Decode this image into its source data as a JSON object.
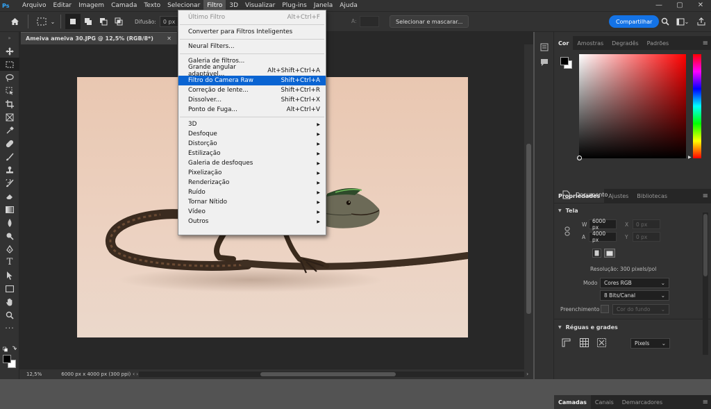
{
  "app": {
    "logo": "Ps"
  },
  "menubar": {
    "items": [
      "Arquivo",
      "Editar",
      "Imagem",
      "Camada",
      "Texto",
      "Selecionar",
      "Filtro",
      "3D",
      "Visualizar",
      "Plug-ins",
      "Janela",
      "Ajuda"
    ]
  },
  "window_controls": {
    "minimize": "—",
    "maximize": "▢",
    "close": "✕"
  },
  "options": {
    "difusao_label": "Difusão:",
    "difusao_value": "0 px",
    "largura_label": "A:",
    "select_mask": "Selecionar e mascarar...",
    "share": "Compartilhar"
  },
  "document": {
    "tab_title": "Ameiva ameiva 30.JPG @ 12,5% (RGB/8*)",
    "zoom": "12,5%",
    "info": "6000 px x 4000 px (300 ppi)"
  },
  "filter_menu": {
    "last_filter": {
      "label": "Último Filtro",
      "shortcut": "Alt+Ctrl+F"
    },
    "smart": "Converter para Filtros Inteligentes",
    "neural": "Neural Filters...",
    "items1": [
      {
        "label": "Galeria de filtros...",
        "shortcut": ""
      },
      {
        "label": "Grande angular adaptável...",
        "shortcut": "Alt+Shift+Ctrl+A"
      },
      {
        "label": "Filtro do Camera Raw",
        "shortcut": "Shift+Ctrl+A"
      },
      {
        "label": "Correção de lente...",
        "shortcut": "Shift+Ctrl+R"
      },
      {
        "label": "Dissolver...",
        "shortcut": "Shift+Ctrl+X"
      },
      {
        "label": "Ponto de Fuga...",
        "shortcut": "Alt+Ctrl+V"
      }
    ],
    "submenus": [
      "3D",
      "Desfoque",
      "Distorção",
      "Estilização",
      "Galeria de desfoques",
      "Pixelização",
      "Renderização",
      "Ruído",
      "Tornar Nítido",
      "Vídeo",
      "Outros"
    ]
  },
  "color_panel": {
    "tabs": [
      "Cor",
      "Amostras",
      "Degradês",
      "Padrões"
    ],
    "accent": "#ff0000"
  },
  "properties": {
    "tabs": [
      "Propriedades",
      "Ajustes",
      "Bibliotecas"
    ],
    "doc_label": "Documento",
    "tela": "Tela",
    "w_label": "W",
    "w_value": "6000 px",
    "h_label": "A",
    "h_value": "4000 px",
    "x_label": "X",
    "x_value": "0 px",
    "y_label": "Y",
    "y_value": "0 px",
    "resolucao": "Resolução: 300 pixels/pol",
    "modo_label": "Modo",
    "modo_value": "Cores RGB",
    "bits_value": "8 Bits/Canal",
    "preenchimento_label": "Preenchimento",
    "preenchimento_value": "Cor do fundo",
    "reguas": "Réguas e grades",
    "units": "Pixels"
  },
  "layers_panel": {
    "tabs": [
      "Camadas",
      "Canais",
      "Demarcadores"
    ]
  }
}
